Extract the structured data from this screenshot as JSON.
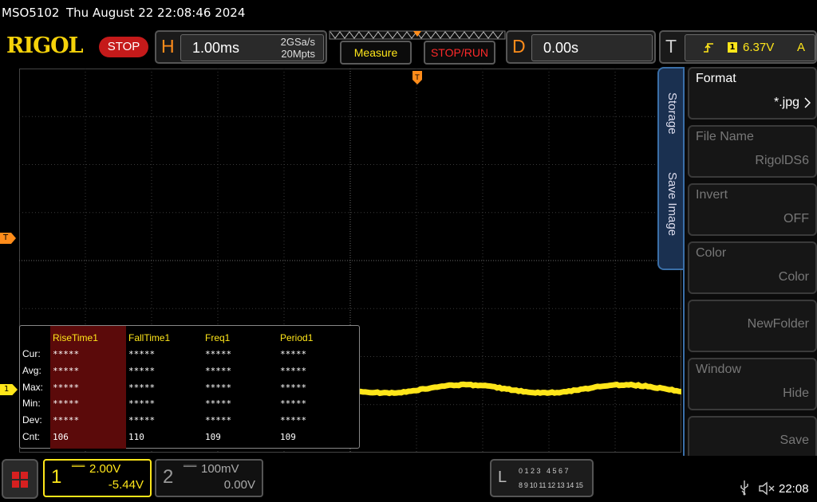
{
  "title": {
    "model": "MSO5102",
    "datetime": "Thu August 22 22:08:46 2024"
  },
  "brand": {
    "logo": "RIGOL",
    "run_state": "STOP"
  },
  "horizontal": {
    "letter": "H",
    "timebase": "1.00ms",
    "sample_rate": "2GSa/s",
    "memory_depth": "20Mpts"
  },
  "buttons": {
    "measure": "Measure",
    "stop_run": "STOP/RUN"
  },
  "delay": {
    "letter": "D",
    "value": "0.00s"
  },
  "trigger": {
    "letter": "T",
    "source": "1",
    "level": "6.37V",
    "mode": "A"
  },
  "markers": {
    "trigger_level": "T",
    "channel1": "1"
  },
  "measure_table": {
    "headers": [
      "RiseTime1",
      "FallTime1",
      "Freq1",
      "Period1"
    ],
    "rows": [
      {
        "label": "Cur:",
        "values": [
          "*****",
          "*****",
          "*****",
          "*****"
        ]
      },
      {
        "label": "Avg:",
        "values": [
          "*****",
          "*****",
          "*****",
          "*****"
        ]
      },
      {
        "label": "Max:",
        "values": [
          "*****",
          "*****",
          "*****",
          "*****"
        ]
      },
      {
        "label": "Min:",
        "values": [
          "*****",
          "*****",
          "*****",
          "*****"
        ]
      },
      {
        "label": "Dev:",
        "values": [
          "*****",
          "*****",
          "*****",
          "*****"
        ]
      },
      {
        "label": "Cnt:",
        "values": [
          "106",
          "110",
          "109",
          "109"
        ]
      }
    ]
  },
  "menu": {
    "tabs": [
      "Storage",
      "Save Image"
    ],
    "items": [
      {
        "title": "Format",
        "value": "*.jpg",
        "enabled": true
      },
      {
        "title": "File Name",
        "value": "RigolDS6",
        "enabled": false
      },
      {
        "title": "Invert",
        "value": "OFF",
        "enabled": false
      },
      {
        "title": "Color",
        "value": "Color",
        "enabled": false
      },
      {
        "title": "",
        "value": "NewFolder",
        "enabled": false
      },
      {
        "title": "Window",
        "value": "Hide",
        "enabled": false
      },
      {
        "title": "",
        "value": "Save",
        "enabled": false
      }
    ]
  },
  "channels": [
    {
      "number": "1",
      "scale": "2.00V",
      "offset": "-5.44V",
      "active": true,
      "color": "#ffe61a"
    },
    {
      "number": "2",
      "scale": "100mV",
      "offset": "0.00V",
      "active": false,
      "color": "#888888"
    }
  ],
  "logic": {
    "letter": "L",
    "row1": "0 1 2 3   4 5 6 7",
    "row2": "8 9 10 11 12 13 14 15"
  },
  "status": {
    "time": "22:08"
  },
  "colors": {
    "ch1": "#ffe61a",
    "accent": "#ff8c1a",
    "stop": "#c51a1a",
    "menu_border": "#3a6fa8"
  }
}
